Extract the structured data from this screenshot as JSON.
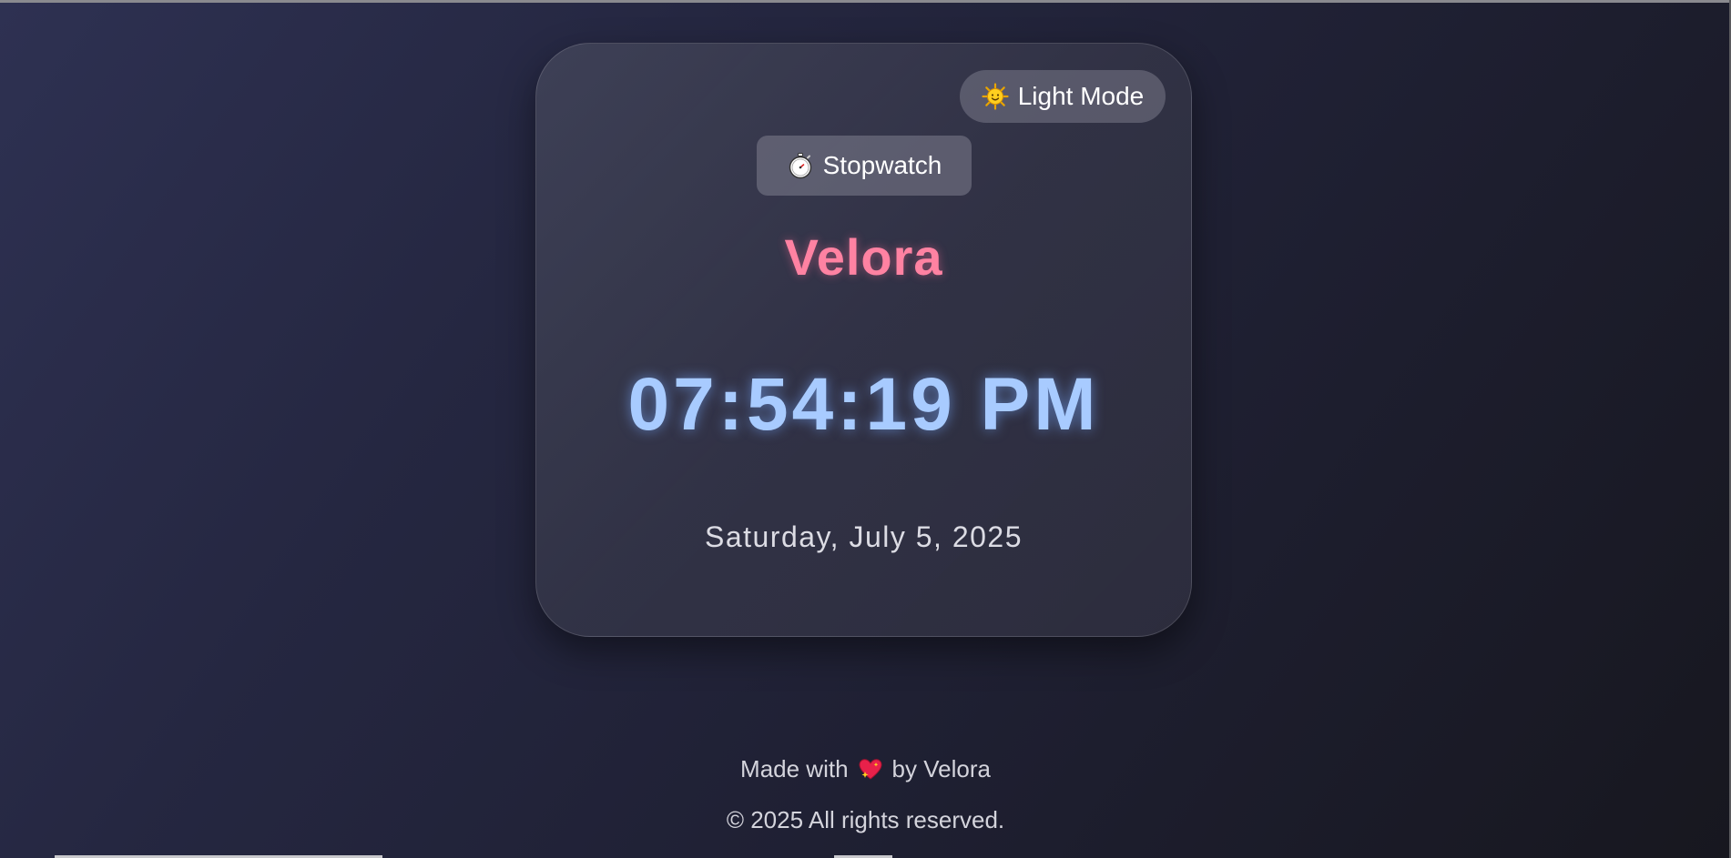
{
  "theme_toggle": {
    "icon": "sun-icon",
    "label": "Light Mode"
  },
  "stopwatch": {
    "icon": "stopwatch-icon",
    "label": "Stopwatch"
  },
  "brand": {
    "title": "Velora"
  },
  "clock": {
    "time": "07:54:19 PM",
    "date": "Saturday, July 5, 2025"
  },
  "footer": {
    "made_prefix": "Made with",
    "heart_icon": "sparkling-heart-icon",
    "made_suffix": "by Velora",
    "copyright": "© 2025 All rights reserved."
  },
  "colors": {
    "accent_pink": "#ff82a2",
    "clock_blue": "#a8cbff",
    "background": "#252741"
  }
}
